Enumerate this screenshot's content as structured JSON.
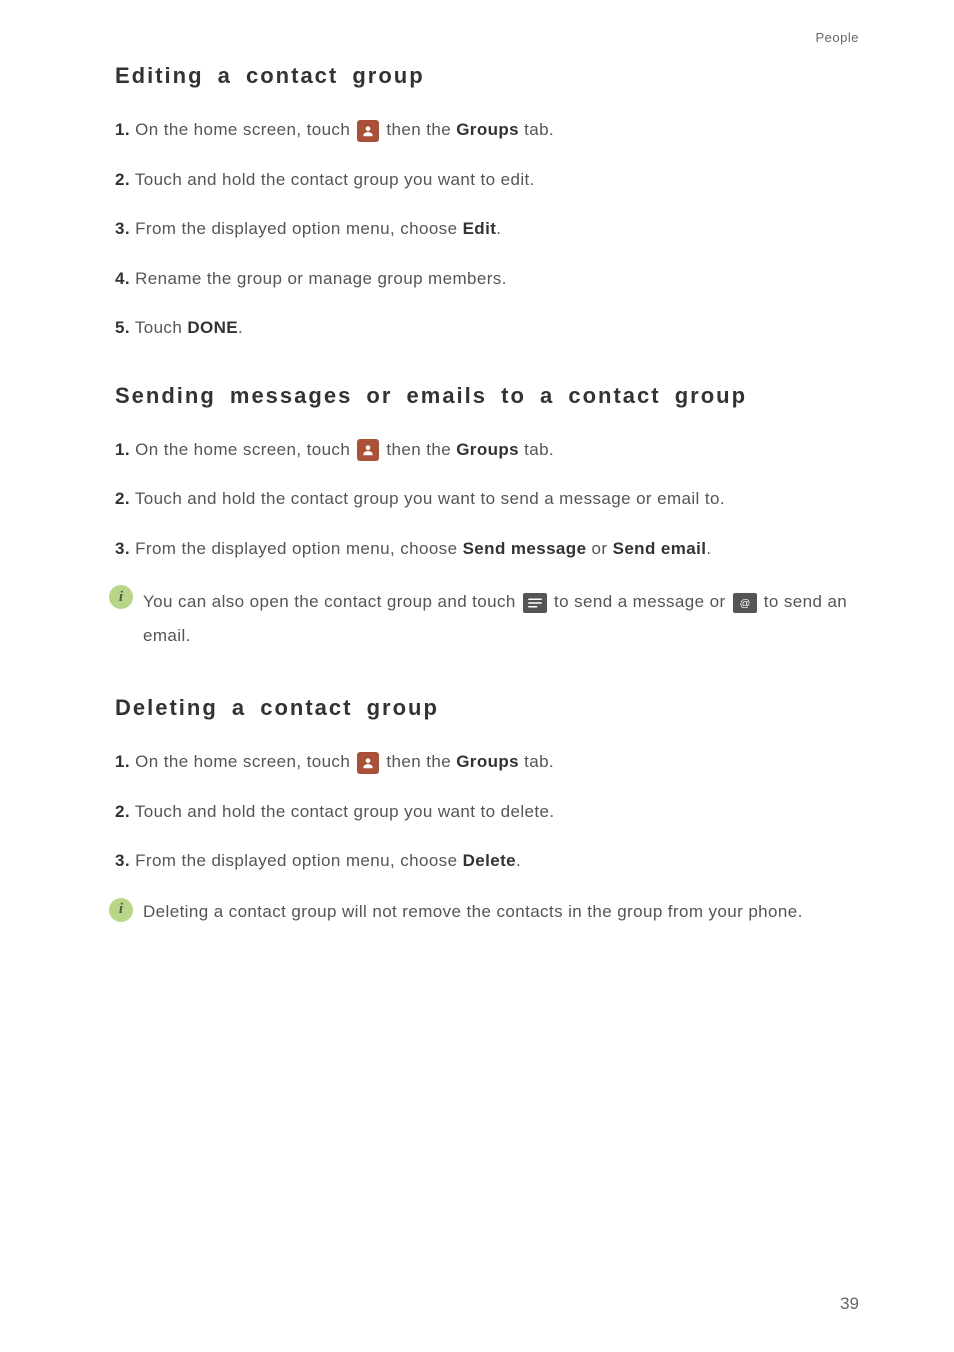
{
  "header": {
    "section": "People"
  },
  "section1": {
    "title": "Editing a contact group",
    "steps": {
      "s1a": "1.",
      "s1b": "On the home screen, touch ",
      "s1c": " then the ",
      "s1d": "Groups",
      "s1e": " tab.",
      "s2a": "2.",
      "s2b": "Touch and hold the contact group you want to edit.",
      "s3a": "3.",
      "s3b": "From the displayed option menu, choose ",
      "s3c": "Edit",
      "s3d": ".",
      "s4a": "4.",
      "s4b": "Rename the group or manage group members.",
      "s5a": "5.",
      "s5b": "Touch ",
      "s5c": "DONE",
      "s5d": "."
    }
  },
  "section2": {
    "title": "Sending messages or emails to a contact group",
    "steps": {
      "s1a": "1.",
      "s1b": "On the home screen, touch ",
      "s1c": " then the ",
      "s1d": "Groups",
      "s1e": " tab.",
      "s2a": "2.",
      "s2b": "Touch and hold the contact group you want to send a message or email to.",
      "s3a": "3.",
      "s3b": "From the displayed option menu, choose ",
      "s3c": "Send message",
      "s3d": " or ",
      "s3e": "Send email",
      "s3f": "."
    },
    "note": {
      "a": "You can also open the contact group and touch ",
      "b": " to send a message or ",
      "c": " to send an email."
    }
  },
  "section3": {
    "title": "Deleting a contact group",
    "steps": {
      "s1a": "1.",
      "s1b": "On the home screen, touch ",
      "s1c": " then the ",
      "s1d": "Groups",
      "s1e": " tab.",
      "s2a": "2.",
      "s2b": "Touch and hold the contact group you want to delete.",
      "s3a": "3.",
      "s3b": "From the displayed option menu, choose ",
      "s3c": "Delete",
      "s3d": "."
    },
    "note": {
      "a": "Deleting a contact group will not remove the contacts in the group from your phone."
    }
  },
  "page_number": "39"
}
